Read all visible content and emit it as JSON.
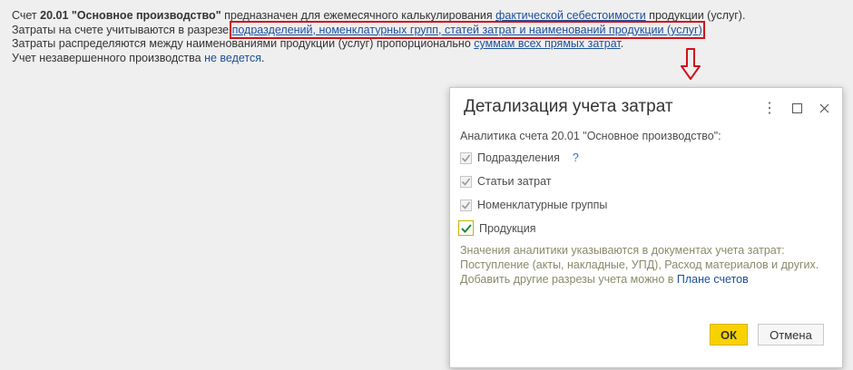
{
  "info": {
    "line1": {
      "p1": "Счет ",
      "account_code": "20.01",
      "account_name": "\"Основное производство\"",
      "p2": " предназначен для ежемесячного калькулирования ",
      "link": "фактической себестоимости",
      "p3": " продукции (услуг)."
    },
    "line2": {
      "p1": "Затраты на счете учитываются в разрезе ",
      "link": "подразделений, номенклатурных групп, статей затрат и наименований продукции (услуг)"
    },
    "line3": {
      "p1": "Затраты распределяются между наименованиями продукции (услуг) пропорционально ",
      "link": "суммам всех прямых затрат",
      "p2": "."
    },
    "line4": {
      "p1": "Учет незавершенного производства ",
      "link": "не ведется",
      "p2": "."
    }
  },
  "colors": {
    "highlight": "#d0121b",
    "link": "#1c4f9c",
    "ok_button": "#f8d200"
  },
  "dialog": {
    "title": "Детализация учета затрат",
    "header_icons": [
      "more-vertical-icon",
      "maximize-icon",
      "close-icon"
    ],
    "section_label": "Аналитика счета 20.01 \"Основное производство\":",
    "checkboxes": [
      {
        "label": "Подразделения",
        "checked": true,
        "enabled": false,
        "help": "?"
      },
      {
        "label": "Статьи затрат",
        "checked": true,
        "enabled": false
      },
      {
        "label": "Номенклатурные группы",
        "checked": true,
        "enabled": false
      },
      {
        "label": "Продукция",
        "checked": true,
        "enabled": true
      }
    ],
    "note": {
      "text": "Значения аналитики указываются в документах учета затрат: Поступление (акты, накладные, УПД), Расход материалов и других.",
      "add_text": "Добавить другие разрезы учета можно в ",
      "add_link": "Плане счетов"
    },
    "buttons": {
      "ok": "ОК",
      "cancel": "Отмена"
    }
  }
}
